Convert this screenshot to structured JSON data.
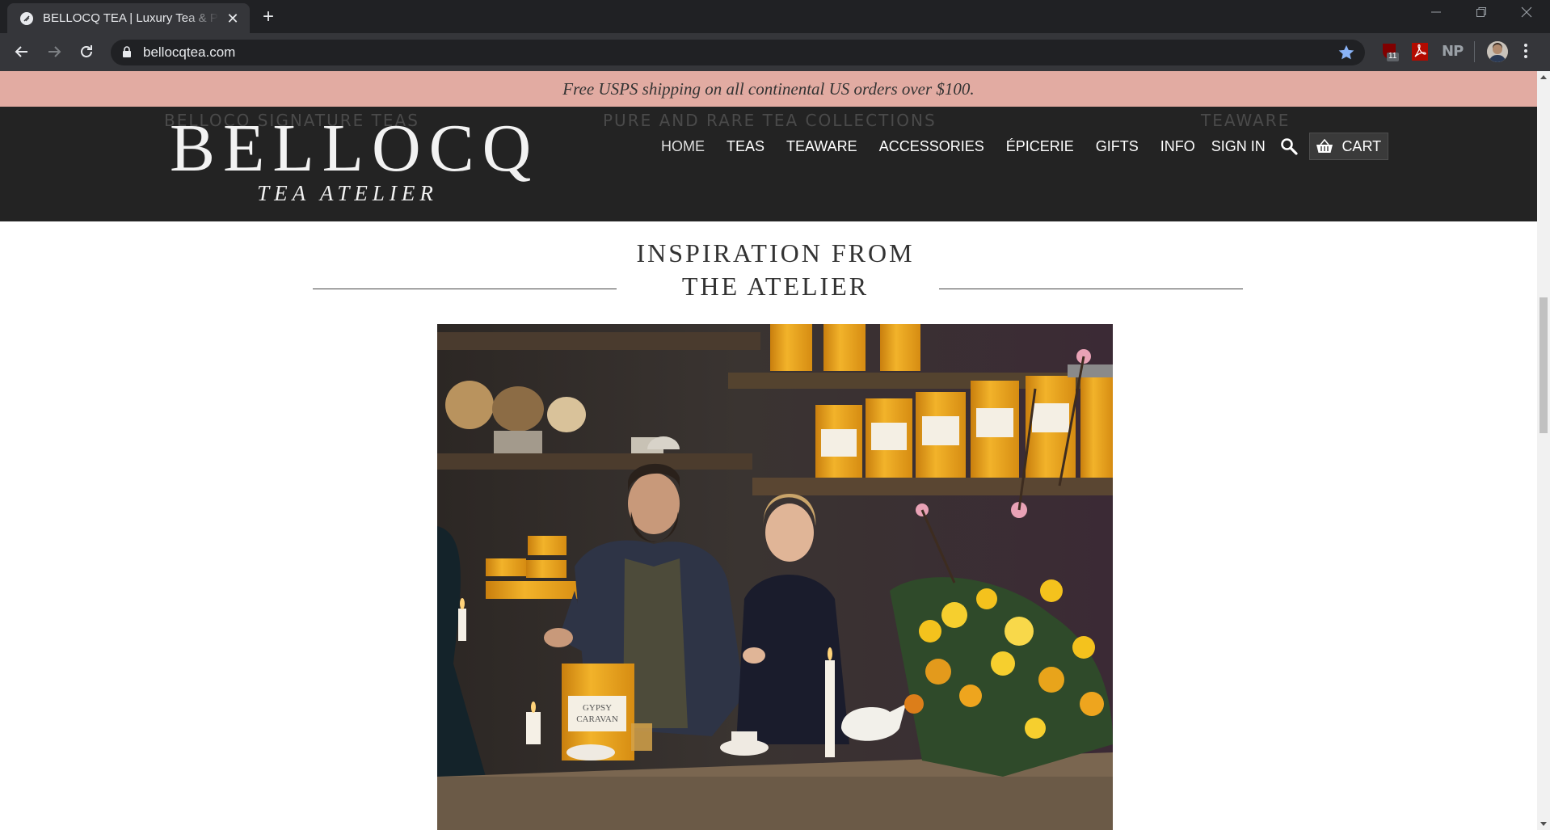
{
  "browser": {
    "tab_title": "BELLOCQ TEA | Luxury Tea & Premium Loose Leaf Tea",
    "url": "bellocqtea.com",
    "ext_badge": "11",
    "ext_np": "NP"
  },
  "promo": {
    "text": "Free USPS shipping on all continental US orders over $100."
  },
  "submenu": {
    "left": "BELLOCQ SIGNATURE TEAS",
    "center": "PURE AND RARE TEA COLLECTIONS",
    "right": "TEAWARE"
  },
  "logo": {
    "main": "BELLOCQ",
    "sub": "TEA ATELIER"
  },
  "nav": {
    "items": [
      "HOME",
      "TEAS",
      "TEAWARE",
      "ACCESSORIES",
      "ÉPICERIE",
      "GIFTS",
      "INFO"
    ],
    "signin": "SIGN IN",
    "cart": "CART"
  },
  "section": {
    "title_line1": "INSPIRATION FROM",
    "title_line2": "THE ATELIER"
  },
  "hero": {
    "label_1": "GYPSY",
    "label_2": "CARAVAN"
  },
  "colors": {
    "promo_bg": "#e2aba2",
    "header_bg": "#232323",
    "accent_tin": "#e9a21c"
  }
}
